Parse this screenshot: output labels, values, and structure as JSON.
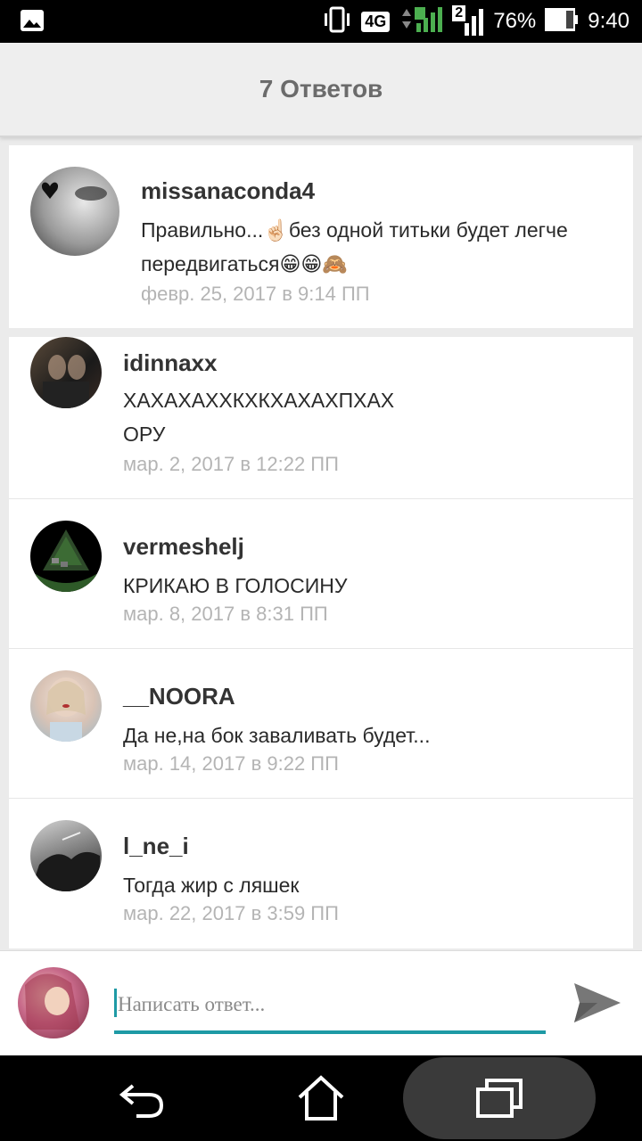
{
  "status_bar": {
    "network": "4G",
    "sim_slot": "2",
    "battery": "76%",
    "time": "9:40",
    "icons": [
      "image-icon",
      "vibrate-icon",
      "signal-icon",
      "battery-icon"
    ]
  },
  "header": {
    "title": "7 Ответов"
  },
  "comments": [
    {
      "username": "missanaconda4",
      "text_line1": "Правильно...☝🏻без одной титьки будет легче",
      "text_line2": "передвигаться😁😁🙈",
      "date": "февр. 25, 2017 в 9:14 ПП"
    },
    {
      "username": "idinnaxx",
      "text_line1": "ХАХАХАХХКХКХАХАХПХАХ",
      "text_line2": "ОРУ",
      "date": "мар. 2, 2017 в 12:22 ПП"
    },
    {
      "username": "vermeshelj",
      "text_line1": "КРИКАЮ В ГОЛОСИНУ",
      "date": "мар. 8, 2017 в 8:31 ПП"
    },
    {
      "username": "__NOORA",
      "text_line1": "Да не,на бок заваливать будет...",
      "date": "мар. 14, 2017 в 9:22 ПП"
    },
    {
      "username": "l_ne_i",
      "text_line1": "Тогда жир с ляшек",
      "date": "мар. 22, 2017 в 3:59 ПП"
    }
  ],
  "reply": {
    "placeholder": "Написать ответ..."
  },
  "nav": {
    "icons": [
      "back-icon",
      "home-icon",
      "recents-icon"
    ]
  },
  "colors": {
    "accent": "#1e9aa5",
    "header_bg": "#eeeeee",
    "date_text": "#b4b4b4"
  }
}
